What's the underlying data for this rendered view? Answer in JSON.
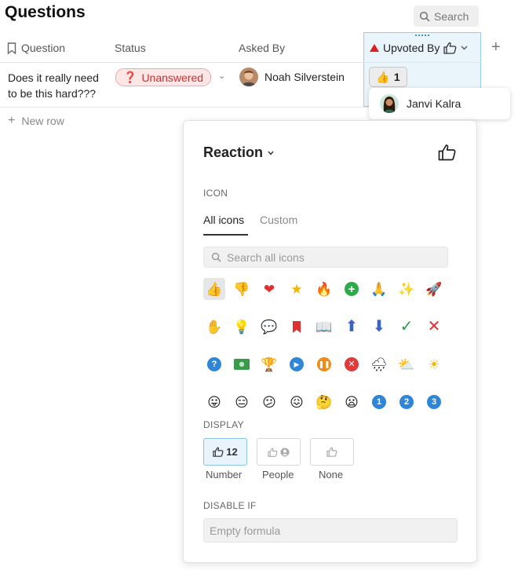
{
  "page": {
    "title": "Questions"
  },
  "toolbar": {
    "search_label": "Search"
  },
  "columns": {
    "question": "Question",
    "status": "Status",
    "asked_by": "Asked By",
    "upvoted_by": "Upvoted By"
  },
  "row": {
    "question": "Does it really need to be this hard???",
    "status": "Unanswered",
    "asked_by": "Noah Silverstein",
    "upvote_count": "1",
    "voter": "Janvi Kalra"
  },
  "new_row_label": "New row",
  "panel": {
    "title": "Reaction",
    "icon_section": "ICON",
    "tabs": [
      "All icons",
      "Custom"
    ],
    "search_placeholder": "Search all icons",
    "icons": [
      "thumbs-up-icon",
      "thumbs-down-icon",
      "heart-icon",
      "star-icon",
      "fire-icon",
      "plus-circle-icon",
      "praying-hands-icon",
      "sparkles-icon",
      "rocket-icon",
      "raised-hand-icon",
      "light-bulb-icon",
      "speech-bubbles-icon",
      "bookmark-icon",
      "reading-person-icon",
      "up-arrow-icon",
      "down-arrow-icon",
      "check-mark-icon",
      "cross-mark-icon",
      "question-icon",
      "money-icon",
      "trophy-icon",
      "play-icon",
      "pause-icon",
      "stop-x-icon",
      "rain-cloud-icon",
      "sun-cloud-icon",
      "sun-icon",
      "grinning-face-icon",
      "neutral-face-icon",
      "slightly-sad-face-icon",
      "confused-face-icon",
      "thinking-face-icon",
      "frowning-face-icon",
      "number-1-icon",
      "number-2-icon",
      "number-3-icon"
    ],
    "display_section": "DISPLAY",
    "display_options": [
      {
        "label": "Number",
        "value": "12"
      },
      {
        "label": "People"
      },
      {
        "label": "None"
      }
    ],
    "disable_section": "DISABLE IF",
    "formula_placeholder": "Empty formula"
  },
  "colors": {
    "accent": "#4a90c8",
    "status_red": "#c93030",
    "selected_bg": "#e8f3fb"
  }
}
